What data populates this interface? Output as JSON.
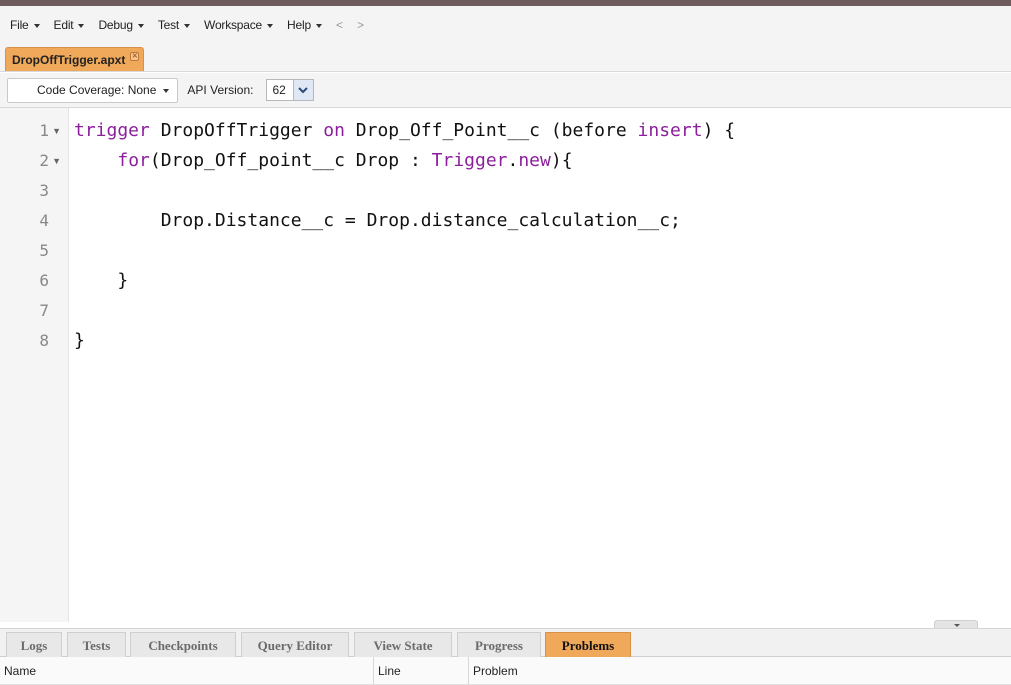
{
  "menu": {
    "items": [
      "File",
      "Edit",
      "Debug",
      "Test",
      "Workspace",
      "Help"
    ],
    "back": "<",
    "forward": ">"
  },
  "tabs": {
    "file_tab": "DropOffTrigger.apxt"
  },
  "toolbar": {
    "coverage_label": "Code Coverage: None",
    "api_label": "API Version:",
    "api_value": "62"
  },
  "editor": {
    "line_numbers": [
      "1",
      "2",
      "3",
      "4",
      "5",
      "6",
      "7",
      "8"
    ],
    "lines": [
      [
        {
          "t": "trigger",
          "k": true
        },
        {
          "t": " DropOffTrigger ",
          "k": false
        },
        {
          "t": "on",
          "k": true
        },
        {
          "t": " Drop_Off_Point__c (before ",
          "k": false
        },
        {
          "t": "insert",
          "k": true
        },
        {
          "t": ") {",
          "k": false
        }
      ],
      [
        {
          "t": "    ",
          "k": false
        },
        {
          "t": "for",
          "k": true
        },
        {
          "t": "(Drop_Off_point__c Drop : ",
          "k": false
        },
        {
          "t": "Trigger",
          "k": true
        },
        {
          "t": ".",
          "k": false
        },
        {
          "t": "new",
          "k": true
        },
        {
          "t": "){",
          "k": false
        }
      ],
      [],
      [
        {
          "t": "        Drop.Distance__c = Drop.distance_calculation__c;",
          "k": false
        }
      ],
      [],
      [
        {
          "t": "    }",
          "k": false
        }
      ],
      [],
      [
        {
          "t": "}",
          "k": false
        }
      ]
    ],
    "keyword_color": "#8b1f9c"
  },
  "bottom_panel": {
    "tabs": [
      "Logs",
      "Tests",
      "Checkpoints",
      "Query Editor",
      "View State",
      "Progress",
      "Problems"
    ],
    "active_tab": "Problems",
    "columns": [
      "Name",
      "Line",
      "Problem"
    ]
  },
  "colors": {
    "accent": "#f0a85a",
    "top_strip": "#6e5b5d"
  }
}
